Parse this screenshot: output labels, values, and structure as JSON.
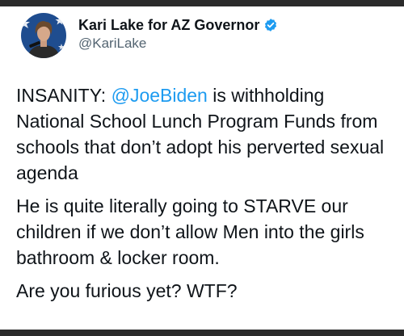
{
  "author": {
    "display_name": "Kari Lake for AZ Governor",
    "handle": "@KariLake",
    "verified_icon": "verified-badge-icon",
    "accent_color": "#1d9bf0"
  },
  "tweet": {
    "p1_prefix": "INSANITY: ",
    "p1_mention": "@JoeBiden",
    "p1_rest": " is withholding National School Lunch Program Funds from schools that don’t adopt his perverted sexual agenda",
    "p2": "He is quite literally going to STARVE our children if we don’t allow Men into the girls bathroom & locker room.",
    "p3": "Are you furious yet? WTF?"
  }
}
